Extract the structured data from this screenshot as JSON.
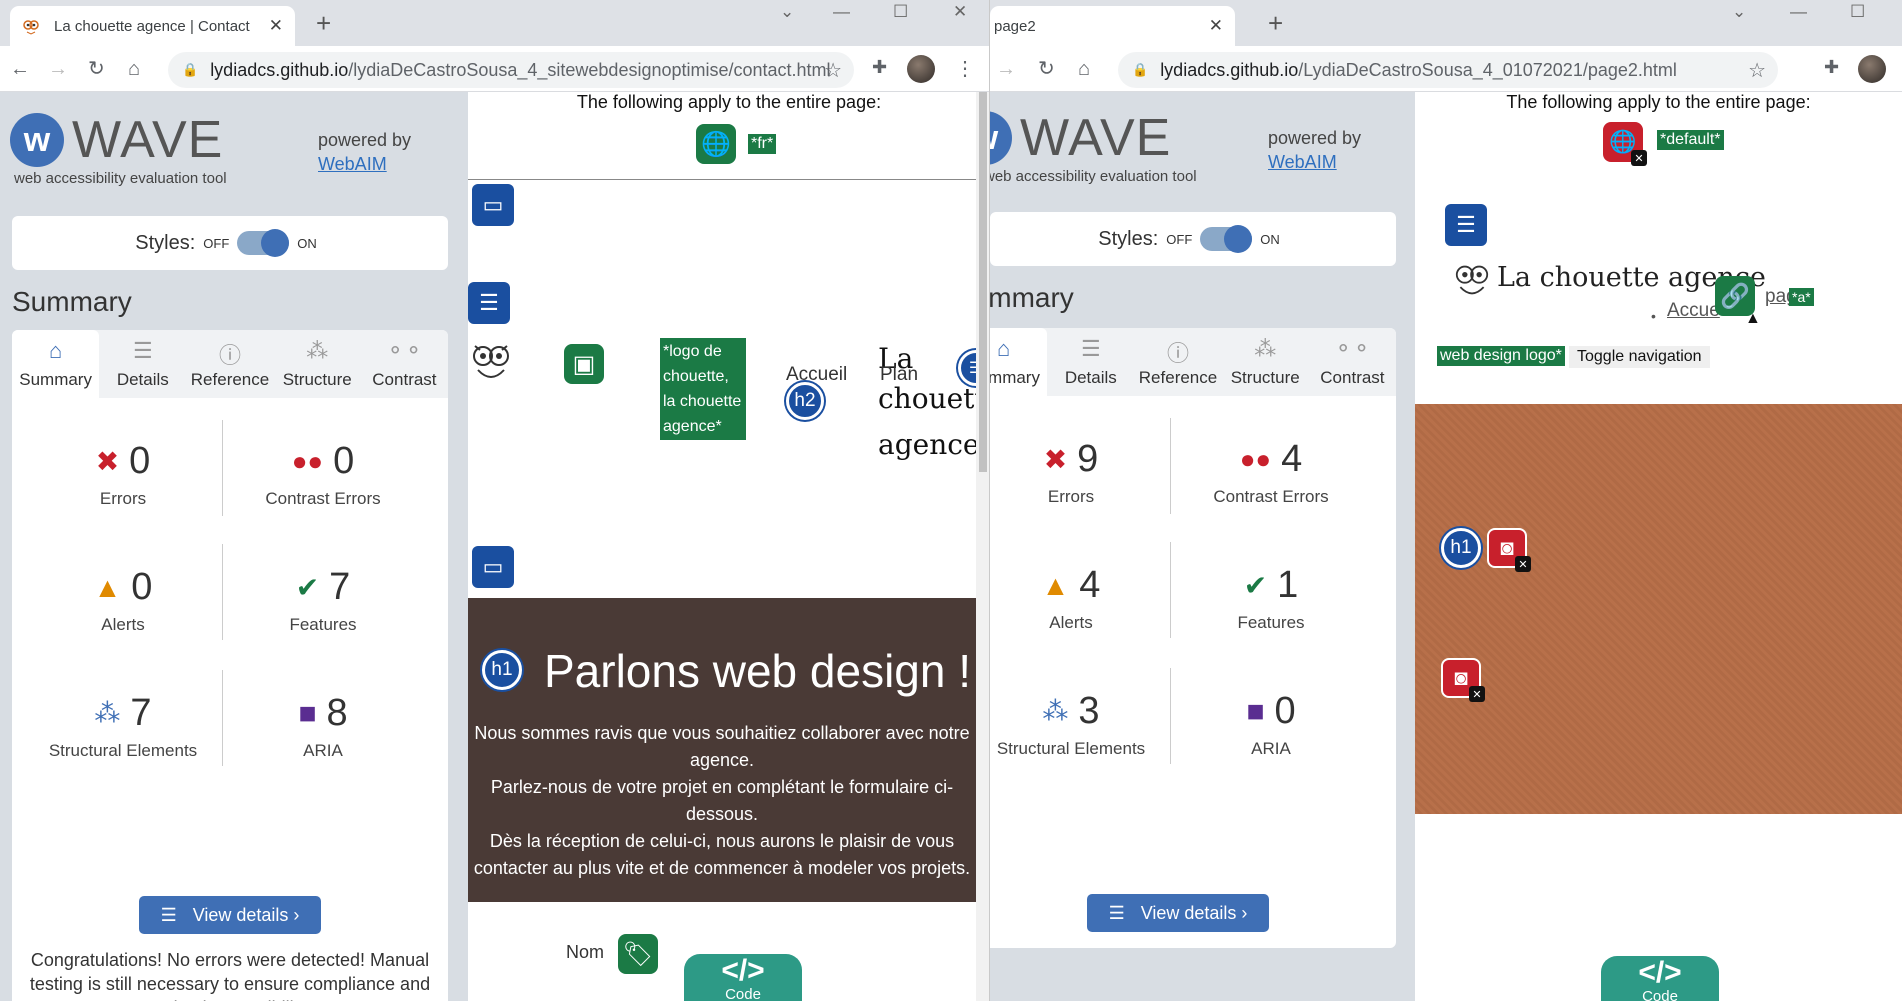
{
  "left": {
    "tab_title": "La chouette agence | Contact",
    "url_host": "lydiadcs.github.io",
    "url_path": "/lydiaDeCastroSousa_4_sitewebdesignoptimise/contact.html",
    "wave": {
      "name": "WAVE",
      "subtitle": "web accessibility evaluation tool",
      "powered_by": "powered by",
      "webaim": "WebAIM",
      "styles_label": "Styles:",
      "off": "OFF",
      "on": "ON",
      "summary_title": "Summary",
      "tabs": [
        "Summary",
        "Details",
        "Reference",
        "Structure",
        "Contrast"
      ],
      "stats": {
        "errors": {
          "value": "0",
          "label": "Errors"
        },
        "contrast": {
          "value": "0",
          "label": "Contrast Errors"
        },
        "alerts": {
          "value": "0",
          "label": "Alerts"
        },
        "features": {
          "value": "7",
          "label": "Features"
        },
        "structural": {
          "value": "7",
          "label": "Structural Elements"
        },
        "aria": {
          "value": "8",
          "label": "ARIA"
        }
      },
      "view_details": "View details ›",
      "congrats": "Congratulations! No errors were detected! Manual testing is still necessary to ensure compliance and optimal accessibility."
    },
    "page": {
      "applies": "The following apply to the entire page:",
      "lang_tag": "*fr*",
      "logo_alt": "*logo de chouette, la chouette agence*",
      "nav_accueil": "Accueil",
      "nav_plan": "Plan",
      "brand_la": "La",
      "brand_chouette": "chouette",
      "brand_agence": "agence",
      "h2": "h2",
      "h1": "h1",
      "hero_title": "Parlons web design !",
      "hero_p1": "Nous sommes ravis que vous souhaitiez collaborer avec notre agence.",
      "hero_p2": "Parlez-nous de votre projet en complétant le formulaire ci-dessous.",
      "hero_p3": "Dès la réception de celui-ci, nous aurons le plaisir de vous contacter au plus vite et de commencer à modeler vos projets.",
      "nom": "Nom",
      "code": "Code"
    }
  },
  "right": {
    "tab_title": "page2",
    "url_host": "lydiadcs.github.io",
    "url_path": "/LydiaDeCastroSousa_4_01072021/page2.html",
    "wave": {
      "name": "WAVE",
      "subtitle": "web accessibility evaluation tool",
      "powered_by": "powered by",
      "webaim": "WebAIM",
      "styles_label": "Styles:",
      "off": "OFF",
      "on": "ON",
      "summary_title": "Summary",
      "tabs": [
        "Summary",
        "Details",
        "Reference",
        "Structure",
        "Contrast"
      ],
      "stats": {
        "errors": {
          "value": "9",
          "label": "Errors"
        },
        "contrast": {
          "value": "4",
          "label": "Contrast Errors"
        },
        "alerts": {
          "value": "4",
          "label": "Alerts"
        },
        "features": {
          "value": "1",
          "label": "Features"
        },
        "structural": {
          "value": "3",
          "label": "Structural Elements"
        },
        "aria": {
          "value": "0",
          "label": "ARIA"
        }
      },
      "view_details": "View details ›"
    },
    "page": {
      "applies": "The following apply to the entire page:",
      "lang_tag": "*default*",
      "brand": "La chouette agence",
      "nav_accueil": "Accue",
      "nav_page": "pag",
      "nav_page_tag": "*a*",
      "logo_tag": "web design logo*",
      "toggle_nav": "Toggle navigation",
      "h1": "h1",
      "code": "Code"
    }
  },
  "colors": {
    "wave_bg": "#d8dde3",
    "wave_blue": "#3f6fb5",
    "feature_green": "#1b7a45",
    "error_red": "#c8202c",
    "structure_blue": "#1a4fa0",
    "hero_brown": "#4a3a36",
    "cork": "#b8704a",
    "code_teal": "#2d9a86"
  }
}
